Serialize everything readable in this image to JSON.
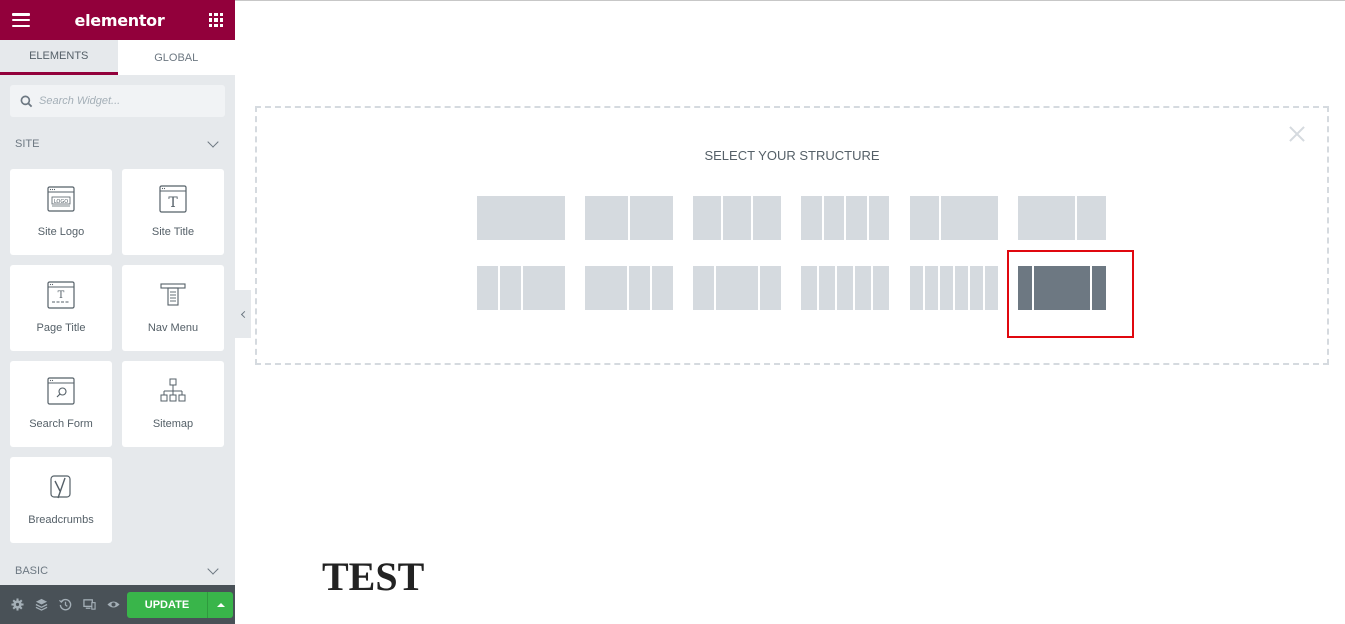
{
  "header": {
    "logo": "elementor",
    "menu_icon": "hamburger-icon",
    "widgets_icon": "grid-icon"
  },
  "tabs": [
    {
      "label": "ELEMENTS",
      "active": true
    },
    {
      "label": "GLOBAL",
      "active": false
    }
  ],
  "search": {
    "placeholder": "Search Widget...",
    "value": ""
  },
  "categories": {
    "site": {
      "label": "SITE",
      "widgets": [
        {
          "label": "Site Logo",
          "icon": "site-logo-icon"
        },
        {
          "label": "Site Title",
          "icon": "site-title-icon"
        },
        {
          "label": "Page Title",
          "icon": "page-title-icon"
        },
        {
          "label": "Nav Menu",
          "icon": "nav-menu-icon"
        },
        {
          "label": "Search Form",
          "icon": "search-form-icon"
        },
        {
          "label": "Sitemap",
          "icon": "sitemap-icon"
        },
        {
          "label": "Breadcrumbs",
          "icon": "breadcrumbs-icon"
        }
      ]
    },
    "basic": {
      "label": "BASIC"
    }
  },
  "footer": {
    "icons": [
      "settings-icon",
      "navigator-icon",
      "history-icon",
      "responsive-icon",
      "preview-icon"
    ],
    "update_label": "UPDATE"
  },
  "structure": {
    "title": "SELECT YOUR STRUCTURE",
    "presets_row1": [
      {
        "name": "100",
        "cols": [
          100
        ]
      },
      {
        "name": "50-50",
        "cols": [
          50,
          50
        ]
      },
      {
        "name": "33-33-33",
        "cols": [
          33,
          33,
          33
        ]
      },
      {
        "name": "25-25-25-25",
        "cols": [
          25,
          25,
          25,
          25
        ]
      },
      {
        "name": "33-66",
        "cols": [
          33,
          66
        ]
      },
      {
        "name": "66-33",
        "cols": [
          66,
          33
        ]
      }
    ],
    "presets_row2": [
      {
        "name": "25-25-50",
        "cols": [
          25,
          25,
          50
        ]
      },
      {
        "name": "50-25-25",
        "cols": [
          50,
          25,
          25
        ]
      },
      {
        "name": "25-50-25",
        "cols": [
          25,
          50,
          25
        ]
      },
      {
        "name": "20-20-20-20-20",
        "cols": [
          20,
          20,
          20,
          20,
          20
        ]
      },
      {
        "name": "16x6",
        "cols": [
          16,
          16,
          16,
          16,
          16,
          16
        ]
      },
      {
        "name": "16-66-16",
        "cols": [
          16,
          66,
          16
        ],
        "selected": true
      }
    ]
  },
  "page": {
    "heading": "TEST"
  },
  "colors": {
    "brand": "#92003b",
    "update": "#39b54a",
    "highlight": "#e0080f",
    "preset_selected": "#6d7882",
    "preset": "#d5dadf"
  }
}
